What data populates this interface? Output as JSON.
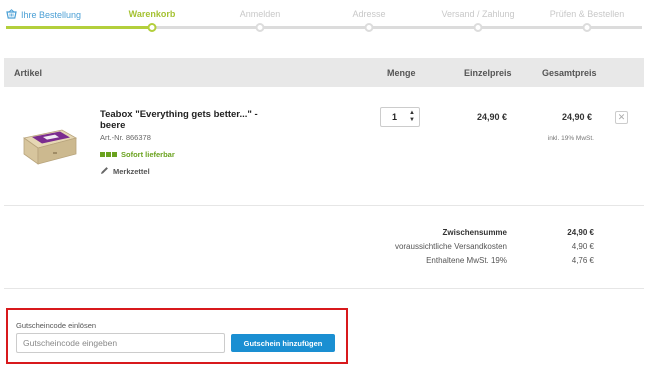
{
  "checkout_steps": [
    {
      "label": "Ihre Bestellung",
      "state": "brand"
    },
    {
      "label": "Warenkorb",
      "state": "active"
    },
    {
      "label": "Anmelden",
      "state": "upcoming"
    },
    {
      "label": "Adresse",
      "state": "upcoming"
    },
    {
      "label": "Versand / Zahlung",
      "state": "upcoming"
    },
    {
      "label": "Prüfen & Bestellen",
      "state": "upcoming"
    }
  ],
  "table_headers": {
    "article": "Artikel",
    "quantity": "Menge",
    "unit_price": "Einzelpreis",
    "total_price": "Gesamtpreis"
  },
  "item": {
    "name": "Teabox \"Everything gets better...\" - beere",
    "article_number": "Art.-Nr. 866378",
    "availability": "Sofort lieferbar",
    "wishlist_label": "Merkzettel",
    "quantity": "1",
    "unit_price": "24,90 €",
    "total_price": "24,90 €",
    "tax_note": "inkl. 19% MwSt."
  },
  "totals": [
    {
      "label": "Zwischensumme",
      "value": "24,90 €",
      "emphasis": true
    },
    {
      "label": "voraussichtliche Versandkosten",
      "value": "4,90 €",
      "emphasis": false
    },
    {
      "label": "Enthaltene MwSt. 19%",
      "value": "4,76 €",
      "emphasis": false
    }
  ],
  "voucher": {
    "title": "Gutscheincode einlösen",
    "placeholder": "Gutscheincode eingeben",
    "button_label": "Gutschein hinzufügen"
  },
  "colors": {
    "accent_green": "#b3cf3c",
    "brand_blue": "#4a9fd5",
    "button_blue": "#1a8fd2",
    "highlight_red": "#d8191c",
    "stock_green": "#6aa21e"
  },
  "icons": {
    "brand": "shopping-basket-icon",
    "wishlist": "pencil-icon",
    "remove": "close-icon",
    "stock": "stock-bars-icon"
  }
}
